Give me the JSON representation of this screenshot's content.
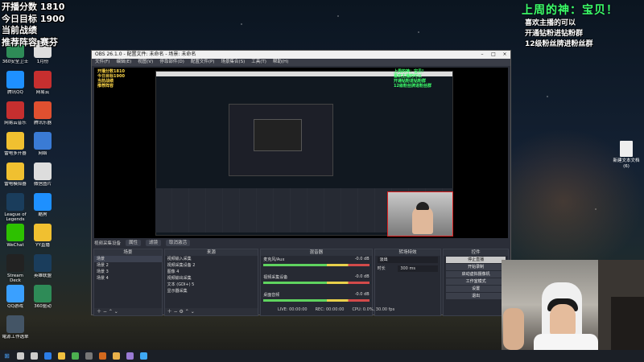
{
  "overlay_left": {
    "line1": "开播分数 1810",
    "line2": "今日目标 1900",
    "line3": "当前战绩",
    "line4": "推荐阵容 赛芬"
  },
  "overlay_right": {
    "title": "上周的神：宝贝！",
    "line1": "喜欢主播的可以",
    "line2": "开通钻粉进钻粉群",
    "line3": "12级粉丝牌进粉丝群"
  },
  "desktop_icons": [
    {
      "label": "360安全卫士",
      "color": "#2e8b57"
    },
    {
      "label": "腾讯QQ",
      "color": "#1e90ff"
    },
    {
      "label": "网易云音乐",
      "color": "#c62f2f"
    },
    {
      "label": "雷电多开器",
      "color": "#f0c030"
    },
    {
      "label": "雷电模拟器",
      "color": "#f0c030"
    },
    {
      "label": "League of Legends",
      "color": "#1a3d5c"
    },
    {
      "label": "WeChat",
      "color": "#2dc100"
    },
    {
      "label": "Stream Deck",
      "color": "#222222"
    },
    {
      "label": "QQ游戏",
      "color": "#3aa0ff"
    },
    {
      "label": "電源工作选单",
      "color": "#445566"
    }
  ],
  "desktop_icons_col2": [
    {
      "label": "1月份",
      "color": "#dddddd"
    },
    {
      "label": "网易云",
      "color": "#c62f2f"
    },
    {
      "label": "腾讯乐器",
      "color": "#e05030"
    },
    {
      "label": "网络",
      "color": "#3a7bd5"
    },
    {
      "label": "微信图片",
      "color": "#dddddd"
    },
    {
      "label": "酷狗",
      "color": "#1e90ff"
    },
    {
      "label": "YY直播",
      "color": "#f0c030"
    },
    {
      "label": "英雄联盟",
      "color": "#1a3d5c"
    },
    {
      "label": "360驱动",
      "color": "#2e8b57"
    }
  ],
  "right_icon": {
    "label": "新建文本文档 (6)"
  },
  "obs": {
    "title": "OBS 26.1.0 - 配置文件: 未命名 - 场景: 未命名",
    "menu": [
      "文件(F)",
      "编辑(E)",
      "视图(V)",
      "停靠部件(D)",
      "配置文件(P)",
      "场景集合(S)",
      "工具(T)",
      "帮助(H)"
    ],
    "dock_row": {
      "label": "视频采集设备",
      "btn1": "属性",
      "btn2": "滤镜",
      "btn3": "取消激活"
    },
    "scenes_title": "场景",
    "scenes": [
      "场景",
      "场景 2",
      "场景 3",
      "场景 4"
    ],
    "sources_title": "来源",
    "sources": [
      "视频输入采集",
      "视频采集设备 2",
      "图像 4",
      "视频输出采集",
      "文本 (GDI+) 5",
      "显示器采集"
    ],
    "mixer_title": "混音器",
    "mixer": [
      {
        "name": "麦克风/Aux",
        "db": "-0.0 dB"
      },
      {
        "name": "视频采集设备",
        "db": "-0.0 dB"
      },
      {
        "name": "桌面音频",
        "db": "-0.0 dB"
      }
    ],
    "transitions_title": "转场特效",
    "transition_value": "淡出",
    "duration_label": "时长",
    "duration_value": "300 ms",
    "controls_title": "控件",
    "controls": [
      "停止直播",
      "开始录制",
      "启动虚拟摄像机",
      "工作室模式",
      "设置",
      "退出"
    ],
    "status": {
      "live": "LIVE: 00:00:00",
      "rec": "REC: 00:00:00",
      "cpu": "CPU: 0.0%, 30.00 fps"
    },
    "preview_left": [
      "开播分数1810",
      "今日目标1900",
      "当前战绩",
      "推荐阵容"
    ],
    "preview_right": [
      "上周的神：宝贝!",
      "喜欢主播的可以",
      "开通钻粉进钻粉群",
      "12级粉丝牌进粉丝群"
    ]
  },
  "taskbar": {
    "start": "⊞",
    "icons": [
      "search",
      "task-view",
      "edge",
      "explorer",
      "chrome",
      "obs",
      "app",
      "folder",
      "media",
      "chat"
    ]
  }
}
